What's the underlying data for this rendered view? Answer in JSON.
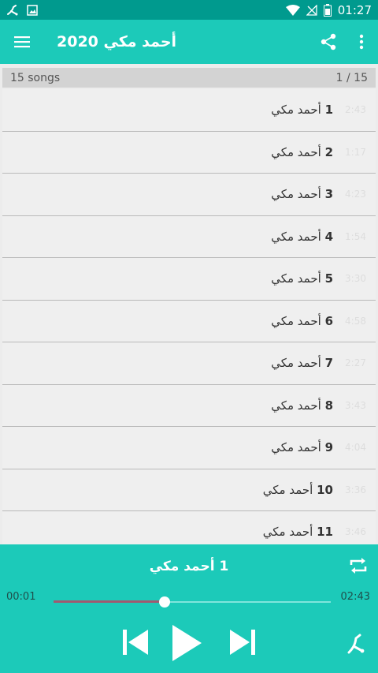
{
  "status_bar": {
    "time": "01:27"
  },
  "app_bar": {
    "title": "أحمد مكي 2020"
  },
  "count_bar": {
    "songs_label": "15 songs",
    "position": "1 / 15"
  },
  "songs": [
    {
      "title": "أحمد مكي",
      "number": "1",
      "duration": "2:43"
    },
    {
      "title": "أحمد مكي",
      "number": "2",
      "duration": "1:17"
    },
    {
      "title": "أحمد مكي",
      "number": "3",
      "duration": "4:23"
    },
    {
      "title": "أحمد مكي",
      "number": "4",
      "duration": "1:54"
    },
    {
      "title": "أحمد مكي",
      "number": "5",
      "duration": "3:30"
    },
    {
      "title": "أحمد مكي",
      "number": "6",
      "duration": "4:58"
    },
    {
      "title": "أحمد مكي",
      "number": "7",
      "duration": "2:27"
    },
    {
      "title": "أحمد مكي",
      "number": "8",
      "duration": "3:43"
    },
    {
      "title": "أحمد مكي",
      "number": "9",
      "duration": "4:04"
    },
    {
      "title": "أحمد مكي",
      "number": "10",
      "duration": "3:36"
    },
    {
      "title": "أحمد مكي",
      "number": "11",
      "duration": "3:46"
    }
  ],
  "player": {
    "now_playing_title": "أحمد مكي",
    "now_playing_number": "1",
    "current_time": "00:01",
    "total_time": "02:43",
    "progress_fraction": 0.4
  },
  "colors": {
    "status_bar": "#009a8e",
    "accent": "#1ccab9",
    "seek_fill": "#a05a70"
  }
}
